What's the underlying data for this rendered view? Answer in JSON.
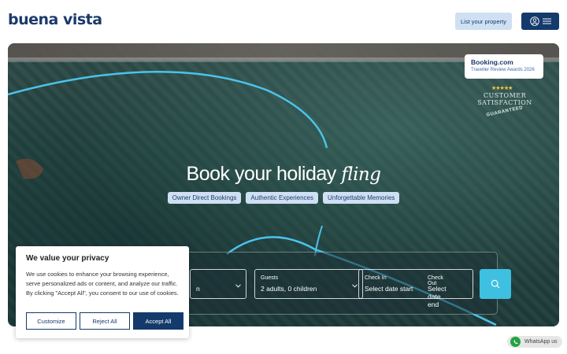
{
  "header": {
    "logo": "buena vista",
    "list_property_label": "List your property"
  },
  "hero": {
    "title_main": "Book your holiday ",
    "title_emphasis": "fling",
    "tags": [
      "Owner Direct Bookings",
      "Authentic Experiences",
      "Unforgettable Memories"
    ]
  },
  "badge": {
    "brand": "Booking.com",
    "subtitle": "Traveller Review Awards 2026",
    "stars": "★★★★★",
    "line1": "CUSTOMER",
    "line2": "SATISFACTION",
    "line3": "GUARANTEED"
  },
  "search": {
    "destination_value": "n",
    "guests_label": "Guests",
    "guests_value": "2 adults, 0 children",
    "checkin_label": "Check In",
    "checkin_placeholder": "Select date start",
    "checkout_label": "Check Out",
    "checkout_placeholder": "Select date end"
  },
  "cookie": {
    "title": "We value your privacy",
    "body": "We use cookies to enhance your browsing experience, serve personalized ads or content, and analyze our traffic. By clicking \"Accept All\", you consent to our use of cookies.",
    "customize_label": "Customize",
    "reject_label": "Reject All",
    "accept_label": "Accept All"
  },
  "whatsapp": {
    "label": "WhatsApp us"
  },
  "colors": {
    "brand_navy": "#143a6c",
    "light_blue": "#cfe0f3",
    "accent_cyan": "#3fc0e0"
  }
}
